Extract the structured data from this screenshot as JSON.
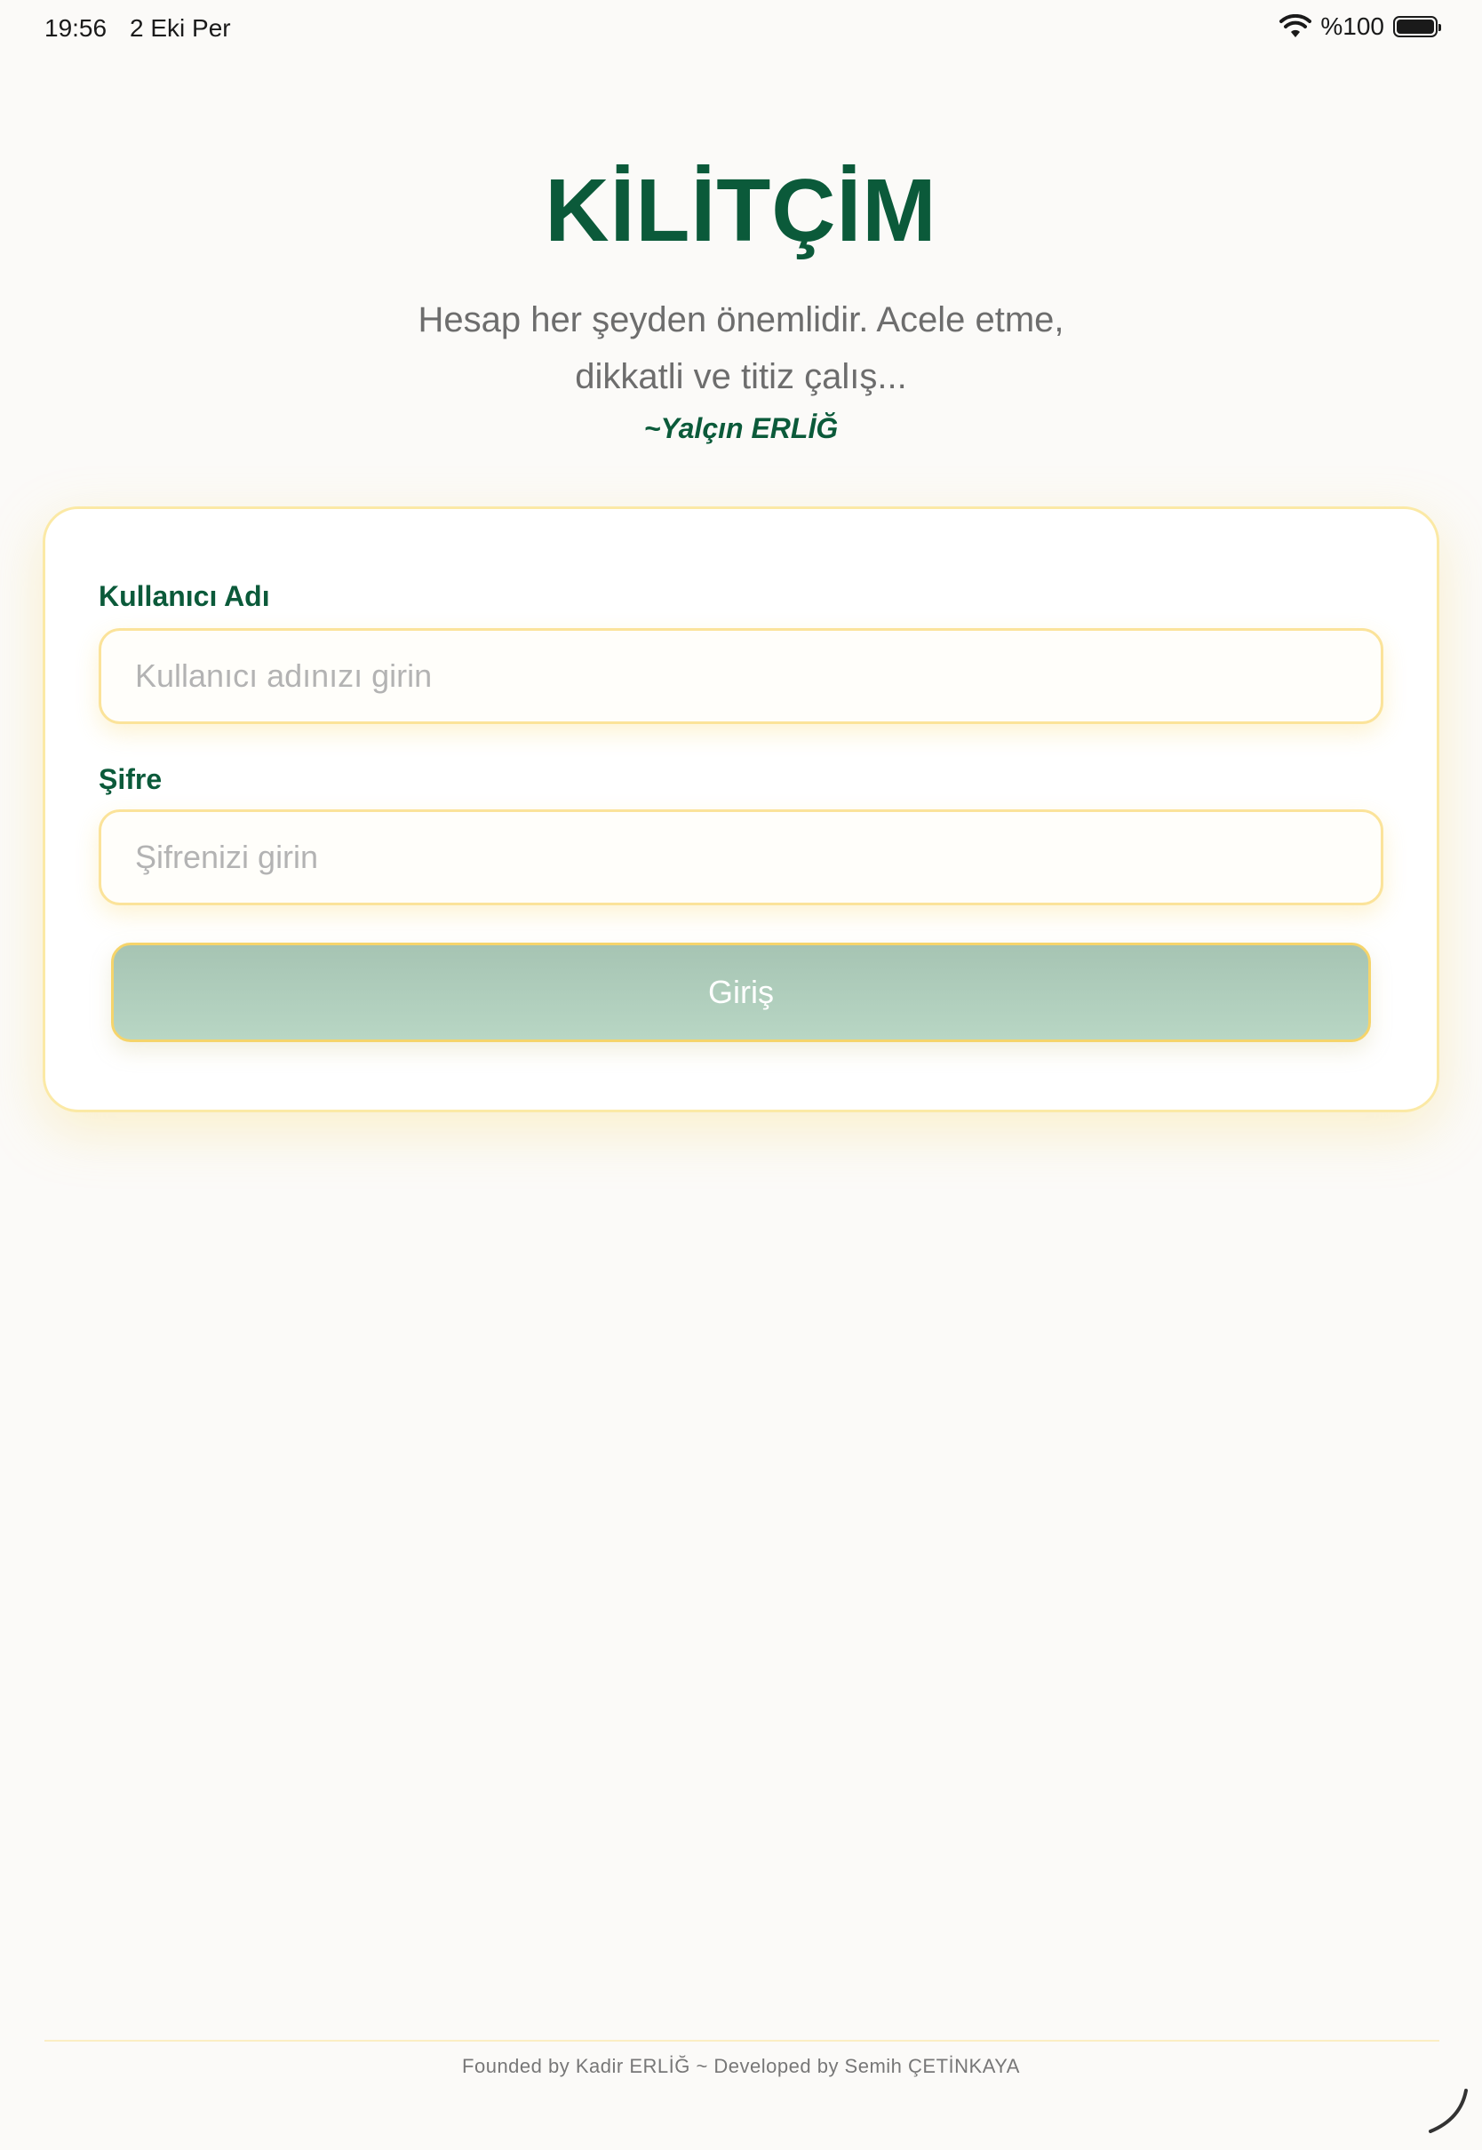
{
  "status_bar": {
    "time": "19:56",
    "date": "2 Eki Per",
    "battery_percent": "%100",
    "wifi_icon": "wifi-icon",
    "battery_icon": "battery-icon"
  },
  "header": {
    "title": "KİLİTÇİM",
    "quote_line1": "Hesap her şeyden önemlidir. Acele etme,",
    "quote_line2": "dikkatli ve titiz çalış...",
    "author": "~Yalçın ERLİĞ"
  },
  "form": {
    "username_label": "Kullanıcı Adı",
    "username_value": "",
    "username_placeholder": "Kullanıcı adınızı girin",
    "password_label": "Şifre",
    "password_value": "",
    "password_placeholder": "Şifrenizi girin",
    "submit_label": "Giriş"
  },
  "footer": {
    "text": "Founded by Kadir ERLİĞ ~ Developed by Semih ÇETİNKAYA"
  },
  "colors": {
    "brand_green": "#0b5a3a",
    "accent_yellow": "#fbe39a",
    "button_green_disabled": "#a6c4b3",
    "background": "#fbfaf8"
  }
}
